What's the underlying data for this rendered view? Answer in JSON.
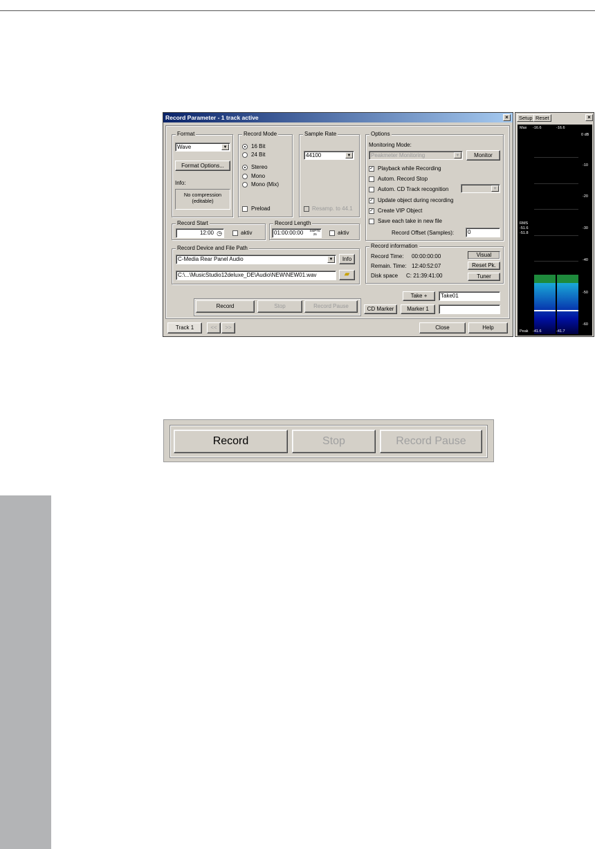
{
  "dialog": {
    "title": "Record Parameter - 1 track active",
    "close_glyph": "×",
    "format": {
      "legend": "Format",
      "value": "Wave",
      "options_button": "Format Options...",
      "info_label": "Info:",
      "info_line1": "No compression",
      "info_line2": "(editable)"
    },
    "record_mode": {
      "legend": "Record Mode",
      "bit16": "16 Bit",
      "bit24": "24 Bit",
      "stereo": "Stereo",
      "mono": "Mono",
      "mono_mix": "Mono (Mix)",
      "preload": "Preload"
    },
    "sample_rate": {
      "legend": "Sample Rate",
      "value": "44100",
      "resamp": "Resamp. to 44.1"
    },
    "options": {
      "legend": "Options",
      "monitoring_label": "Monitoring Mode:",
      "monitoring_value": "Peakmeter Monitoring",
      "monitor_button": "Monitor",
      "playback": "Playback while Recording",
      "autom_stop": "Autom. Record Stop",
      "autom_cd": "Autom. CD Track recognition",
      "update_obj": "Update object during recording",
      "create_vip": "Create VIP Object",
      "save_take": "Save each take in new file",
      "offset_label": "Record Offset (Samples):",
      "offset_value": "0"
    },
    "record_start": {
      "legend": "Record Start",
      "value": "12:00",
      "aktiv": "aktiv"
    },
    "record_length": {
      "legend": "Record Length",
      "value": "01:00:00:00",
      "smpte_top": "SMPTE",
      "smpte_bottom": "25",
      "aktiv": "aktiv"
    },
    "device": {
      "legend": "Record Device and File Path",
      "value": "C-Media Rear Panel Audio",
      "info_button": "Info",
      "path": "C:\\...\\MusicStudio12deluxe_DE\\Audio\\NEW\\NEW01.wav"
    },
    "record_info": {
      "legend": "Record information",
      "record_time_label": "Record Time:",
      "record_time": "00:00:00:00",
      "remain_label": "Remain. Time:",
      "remain_time": "12:40:52:07",
      "disk_label": "Disk space",
      "disk_value": "C: 21:39:41:00",
      "visual": "Visual",
      "reset_pk": "Reset Pk.",
      "tuner": "Tuner"
    },
    "take_button": "Take +",
    "take_value": "Take01",
    "cd_marker": "CD Marker",
    "marker1": "Marker 1",
    "marker_value": "",
    "record": "Record",
    "stop": "Stop",
    "record_pause": "Record Pause",
    "track_tab": "Track 1",
    "prev": "<<",
    "next": ">>",
    "close": "Close",
    "help": "Help"
  },
  "meter": {
    "setup": "Setup",
    "reset": "Reset",
    "close_glyph": "×",
    "max_label": "Max",
    "max_left": "-16.6",
    "max_right": "-16.6",
    "scale": [
      "0 dB",
      "-10",
      "-20",
      "-30",
      "-40",
      "-50",
      "-60"
    ],
    "rms_label": "RMS",
    "rms_left": "-51.6",
    "rms_right": "-51.8",
    "peak_label": "Peak",
    "peak_left": "-41.6",
    "peak_right": "-41.7",
    "colors": {
      "green": "#1e8a3c",
      "blue_top": "#1aa9d8",
      "blue_bottom": "#0010a0"
    }
  },
  "zoom": {
    "record": "Record",
    "stop": "Stop",
    "record_pause": "Record Pause"
  }
}
